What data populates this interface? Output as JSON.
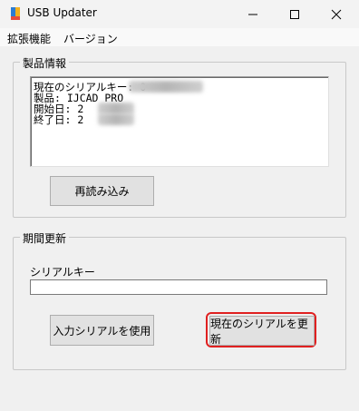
{
  "window": {
    "title": "USB Updater",
    "icons": {
      "app": "app-icon",
      "minimize": "minimize-icon",
      "maximize": "maximize-icon",
      "close": "close-icon"
    }
  },
  "menu": {
    "items": [
      "拡張機能",
      "バージョン"
    ]
  },
  "product_group": {
    "title": "製品情報",
    "lines": [
      "現在のシリアルキー: 0",
      "製品: IJCAD PRO",
      "開始日: 2",
      "終了日: 2"
    ],
    "reload_button": "再読み込み"
  },
  "update_group": {
    "title": "期間更新",
    "serial_label": "シリアルキー",
    "serial_value": "",
    "use_input_button": "入力シリアルを使用",
    "update_current_button": "現在のシリアルを更新"
  },
  "colors": {
    "highlight": "#e02020"
  }
}
